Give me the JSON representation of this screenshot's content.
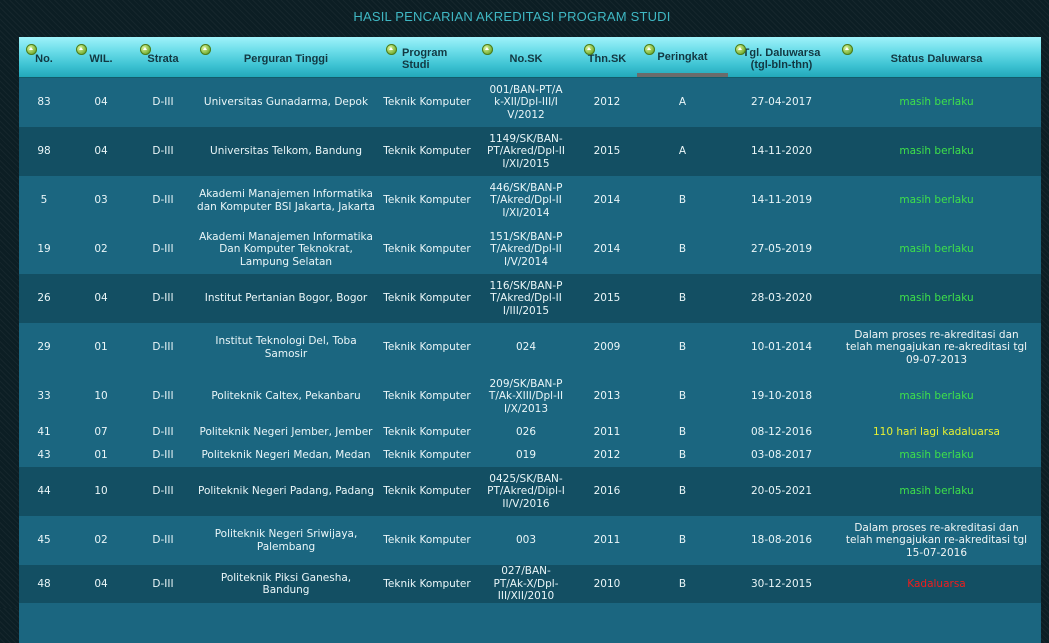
{
  "title": "HASIL PENCARIAN AKREDITASI PROGRAM STUDI",
  "headers": [
    "No.",
    "WIL.",
    "Strata",
    "Perguran Tinggi",
    "Program Studi",
    "No.SK",
    "Thn.SK",
    "Peringkat",
    "Tgl. Daluwarsa (tgl-bln-thn)",
    "Status Daluwarsa"
  ],
  "colors": {
    "header_gradient_top": "#9ff2fa",
    "row_odd": "#1b6680",
    "row_even": "#134f63",
    "status_green": "#3ee04a",
    "status_yellow": "#e6f032",
    "status_red": "#f01d1d",
    "title": "#3fb8c4"
  },
  "rows": [
    {
      "no": "83",
      "wil": "04",
      "strata": "D-III",
      "pt": "Universitas Gunadarma, Depok",
      "prodi": "Teknik Komputer",
      "sk": "001/BAN-PT/Ak-XII/Dpl-III/IV/2012",
      "thn": "2012",
      "peringkat": "A",
      "tgl": "27-04-2017",
      "status": "masih berlaku",
      "status_type": "green"
    },
    {
      "no": "98",
      "wil": "04",
      "strata": "D-III",
      "pt": "Universitas Telkom, Bandung",
      "prodi": "Teknik Komputer",
      "sk": "1149/SK/BAN-PT/Akred/Dpl-III/XI/2015",
      "thn": "2015",
      "peringkat": "A",
      "tgl": "14-11-2020",
      "status": "masih berlaku",
      "status_type": "green"
    },
    {
      "no": "5",
      "wil": "03",
      "strata": "D-III",
      "pt": "Akademi Manajemen Informatika dan Komputer BSI Jakarta, Jakarta",
      "prodi": "Teknik Komputer",
      "sk": "446/SK/BAN-PT/Akred/Dpl-III/XI/2014",
      "thn": "2014",
      "peringkat": "B",
      "tgl": "14-11-2019",
      "status": "masih berlaku",
      "status_type": "green"
    },
    {
      "no": "19",
      "wil": "02",
      "strata": "D-III",
      "pt": "Akademi Manajemen Informatika Dan Komputer Teknokrat, Lampung Selatan",
      "prodi": "Teknik Komputer",
      "sk": "151/SK/BAN-PT/Akred/Dpl-III/V/2014",
      "thn": "2014",
      "peringkat": "B",
      "tgl": "27-05-2019",
      "status": "masih berlaku",
      "status_type": "green"
    },
    {
      "no": "26",
      "wil": "04",
      "strata": "D-III",
      "pt": "Institut Pertanian Bogor, Bogor",
      "prodi": "Teknik Komputer",
      "sk": "116/SK/BAN-PT/Akred/Dpl-III/III/2015",
      "thn": "2015",
      "peringkat": "B",
      "tgl": "28-03-2020",
      "status": "masih berlaku",
      "status_type": "green"
    },
    {
      "no": "29",
      "wil": "01",
      "strata": "D-III",
      "pt": "Institut Teknologi Del, Toba Samosir",
      "prodi": "Teknik Komputer",
      "sk": "024",
      "thn": "2009",
      "peringkat": "B",
      "tgl": "10-01-2014",
      "status": "Dalam proses re-akreditasi dan telah mengajukan re-akreditasi tgl 09-07-2013",
      "status_type": "white"
    },
    {
      "no": "33",
      "wil": "10",
      "strata": "D-III",
      "pt": "Politeknik Caltex, Pekanbaru",
      "prodi": "Teknik Komputer",
      "sk": "209/SK/BAN-PT/Ak-XIII/Dpl-III/X/2013",
      "thn": "2013",
      "peringkat": "B",
      "tgl": "19-10-2018",
      "status": "masih berlaku",
      "status_type": "green"
    },
    {
      "no": "41",
      "wil": "07",
      "strata": "D-III",
      "pt": "Politeknik Negeri Jember, Jember",
      "prodi": "Teknik Komputer",
      "sk": "026",
      "thn": "2011",
      "peringkat": "B",
      "tgl": "08-12-2016",
      "status": "110 hari lagi kadaluarsa",
      "status_type": "yellow"
    },
    {
      "no": "43",
      "wil": "01",
      "strata": "D-III",
      "pt": "Politeknik Negeri Medan, Medan",
      "prodi": "Teknik Komputer",
      "sk": "019",
      "thn": "2012",
      "peringkat": "B",
      "tgl": "03-08-2017",
      "status": "masih berlaku",
      "status_type": "green"
    },
    {
      "no": "44",
      "wil": "10",
      "strata": "D-III",
      "pt": "Politeknik Negeri Padang, Padang",
      "prodi": "Teknik Komputer",
      "sk": "0425/SK/BAN-PT/Akred/Dipl-III/V/2016",
      "thn": "2016",
      "peringkat": "B",
      "tgl": "20-05-2021",
      "status": "masih berlaku",
      "status_type": "green"
    },
    {
      "no": "45",
      "wil": "02",
      "strata": "D-III",
      "pt": "Politeknik Negeri Sriwijaya, Palembang",
      "prodi": "Teknik Komputer",
      "sk": "003",
      "thn": "2011",
      "peringkat": "B",
      "tgl": "18-08-2016",
      "status": "Dalam proses re-akreditasi dan telah mengajukan re-akreditasi tgl 15-07-2016",
      "status_type": "white"
    },
    {
      "no": "48",
      "wil": "04",
      "strata": "D-III",
      "pt": "Politeknik Piksi Ganesha, Bandung",
      "prodi": "Teknik Komputer",
      "sk": "027/BAN-PT/Ak-X/Dpl-III/XII/2010",
      "thn": "2010",
      "peringkat": "B",
      "tgl": "30-12-2015",
      "status": "Kadaluarsa",
      "status_type": "red"
    }
  ]
}
